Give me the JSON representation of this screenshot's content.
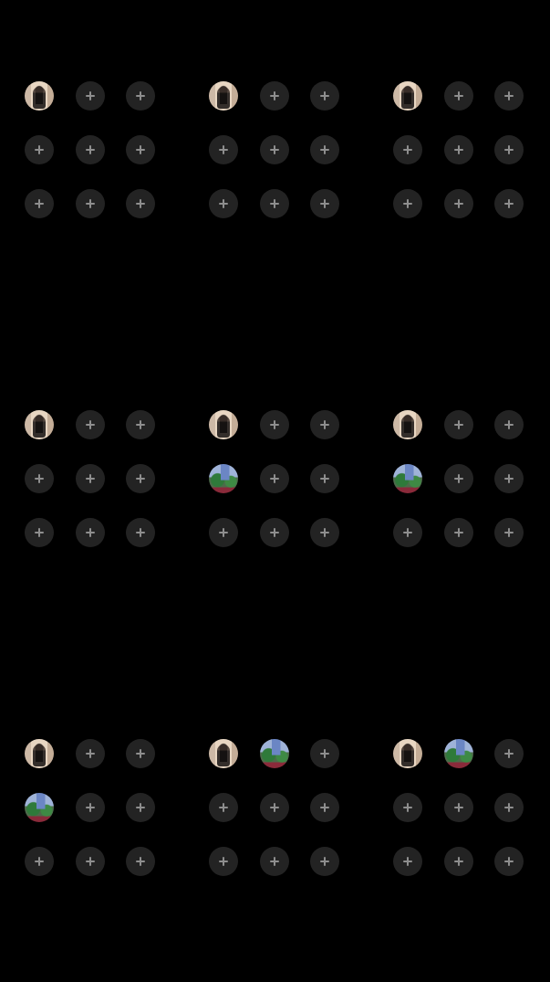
{
  "colors": {
    "background": "#000000",
    "add_button_bg": "#232323",
    "plus_glyph": "#8e8e8e"
  },
  "icons": {
    "add": "plus-icon",
    "photo_person": "person-photo-thumbnail",
    "photo_street": "street-photo-thumbnail"
  },
  "grids": [
    {
      "cells": [
        "person",
        "add",
        "add",
        "add",
        "add",
        "add",
        "add",
        "add",
        "add"
      ]
    },
    {
      "cells": [
        "person",
        "add",
        "add",
        "add",
        "add",
        "add",
        "add",
        "add",
        "add"
      ]
    },
    {
      "cells": [
        "person",
        "add",
        "add",
        "add",
        "add",
        "add",
        "add",
        "add",
        "add"
      ]
    },
    {
      "cells": [
        "person",
        "add",
        "add",
        "add",
        "add",
        "add",
        "add",
        "add",
        "add"
      ]
    },
    {
      "cells": [
        "person",
        "add",
        "add",
        "street",
        "add",
        "add",
        "add",
        "add",
        "add"
      ]
    },
    {
      "cells": [
        "person",
        "add",
        "add",
        "street",
        "add",
        "add",
        "add",
        "add",
        "add"
      ]
    },
    {
      "cells": [
        "person",
        "add",
        "add",
        "street",
        "add",
        "add",
        "add",
        "add",
        "add"
      ]
    },
    {
      "cells": [
        "person",
        "street",
        "add",
        "add",
        "add",
        "add",
        "add",
        "add",
        "add"
      ]
    },
    {
      "cells": [
        "person",
        "street",
        "add",
        "add",
        "add",
        "add",
        "add",
        "add",
        "add"
      ]
    }
  ]
}
